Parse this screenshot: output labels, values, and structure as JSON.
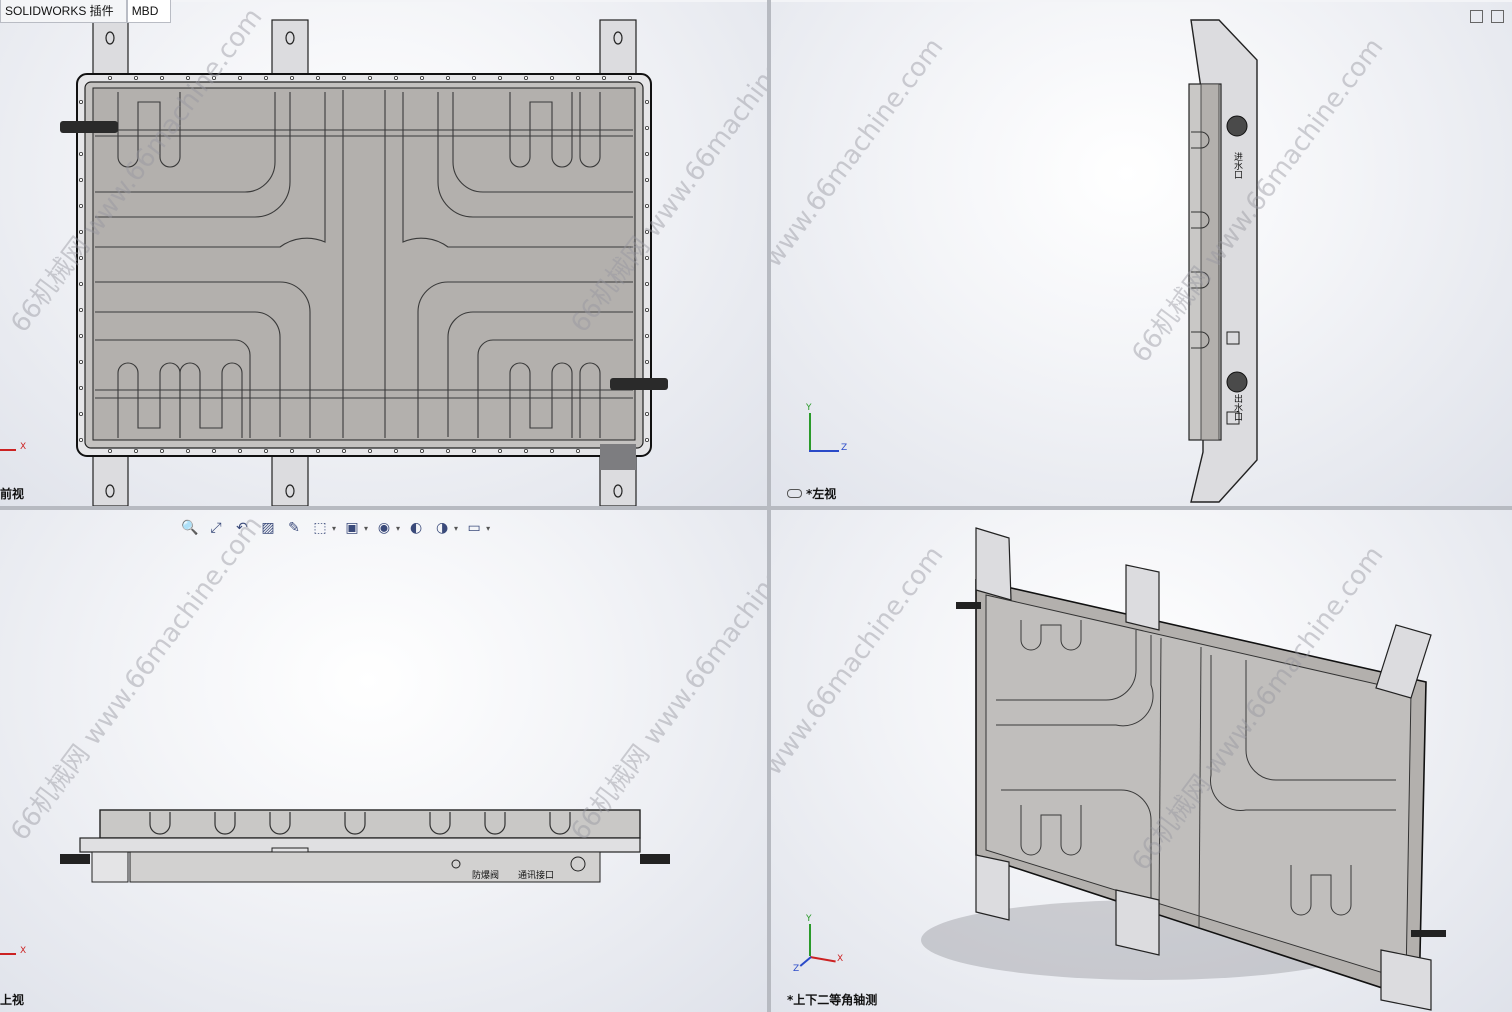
{
  "app": {
    "tabs": [
      "SOLIDWORKS 插件",
      "MBD"
    ]
  },
  "viewports": {
    "front": {
      "label": "前视"
    },
    "left": {
      "label": "*左视"
    },
    "top": {
      "label": "上视"
    },
    "iso": {
      "label": "*上下二等角轴测"
    }
  },
  "axis": {
    "x": "X",
    "y": "Y",
    "z": "Z"
  },
  "part_labels": {
    "label_a": "进水口",
    "label_b": "出水口",
    "label_c": "通讯接口",
    "label_d": "防爆阀"
  },
  "watermark": "66机械网 www.66machine.com",
  "hud_icons": [
    "zoom-to-fit-icon",
    "zoom-area-icon",
    "previous-view-icon",
    "section-view-icon",
    "dynamic-annotation-icon",
    "view-orientation-icon",
    "display-style-icon",
    "hide-show-icon",
    "edit-appearance-icon",
    "apply-scene-icon",
    "view-settings-icon"
  ],
  "colors": {
    "part_fill": "#b3b0ad",
    "part_edge": "#1a1a1a",
    "viewport_bg": "#e4e6ec",
    "bracket_fill": "#d9d9dc"
  }
}
